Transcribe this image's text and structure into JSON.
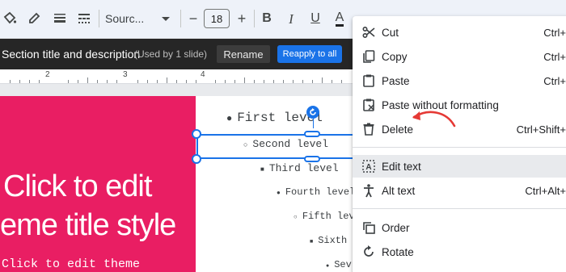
{
  "toolbar": {
    "font_family": "Sourc...",
    "font_size": "18",
    "minus": "−",
    "plus": "+",
    "bold": "B",
    "italic": "I",
    "underline": "U",
    "text_color": "A",
    "icons": [
      "paint-format-icon",
      "highlighter-icon",
      "line-weight-icon",
      "line-dash-icon",
      "bold-icon",
      "italic-icon",
      "underline-icon",
      "text-color-icon",
      "fill-color-icon"
    ]
  },
  "section": {
    "title": "Section title and description",
    "used": "(Used by 1 slide)",
    "rename_label": "Rename",
    "reapply_label": "Reapply to all"
  },
  "ruler": {
    "labels": [
      "2",
      "3",
      "4"
    ]
  },
  "slide": {
    "title_line1": "Click to edit",
    "title_line2": "eme title style",
    "subtitle": "Click to edit theme",
    "levels": [
      "First level",
      "Second level",
      "Third level",
      "Fourth level",
      "Fifth lev",
      "Sixth",
      "Sev"
    ],
    "colors": {
      "panel": "#e91e63",
      "selection": "#1a73e8"
    }
  },
  "menu": {
    "cut": {
      "label": "Cut",
      "shortcut": "Ctrl+"
    },
    "copy": {
      "label": "Copy",
      "shortcut": "Ctrl+"
    },
    "paste": {
      "label": "Paste",
      "shortcut": "Ctrl+"
    },
    "paste_plain": {
      "label": "Paste without formatting",
      "shortcut": ""
    },
    "delete": {
      "label": "Delete",
      "shortcut": "Ctrl+Shift+"
    },
    "edit_text": {
      "label": "Edit text",
      "shortcut": ""
    },
    "alt_text": {
      "label": "Alt text",
      "shortcut": "Ctrl+Alt+"
    },
    "order": {
      "label": "Order",
      "shortcut": ""
    },
    "rotate": {
      "label": "Rotate",
      "shortcut": ""
    }
  }
}
